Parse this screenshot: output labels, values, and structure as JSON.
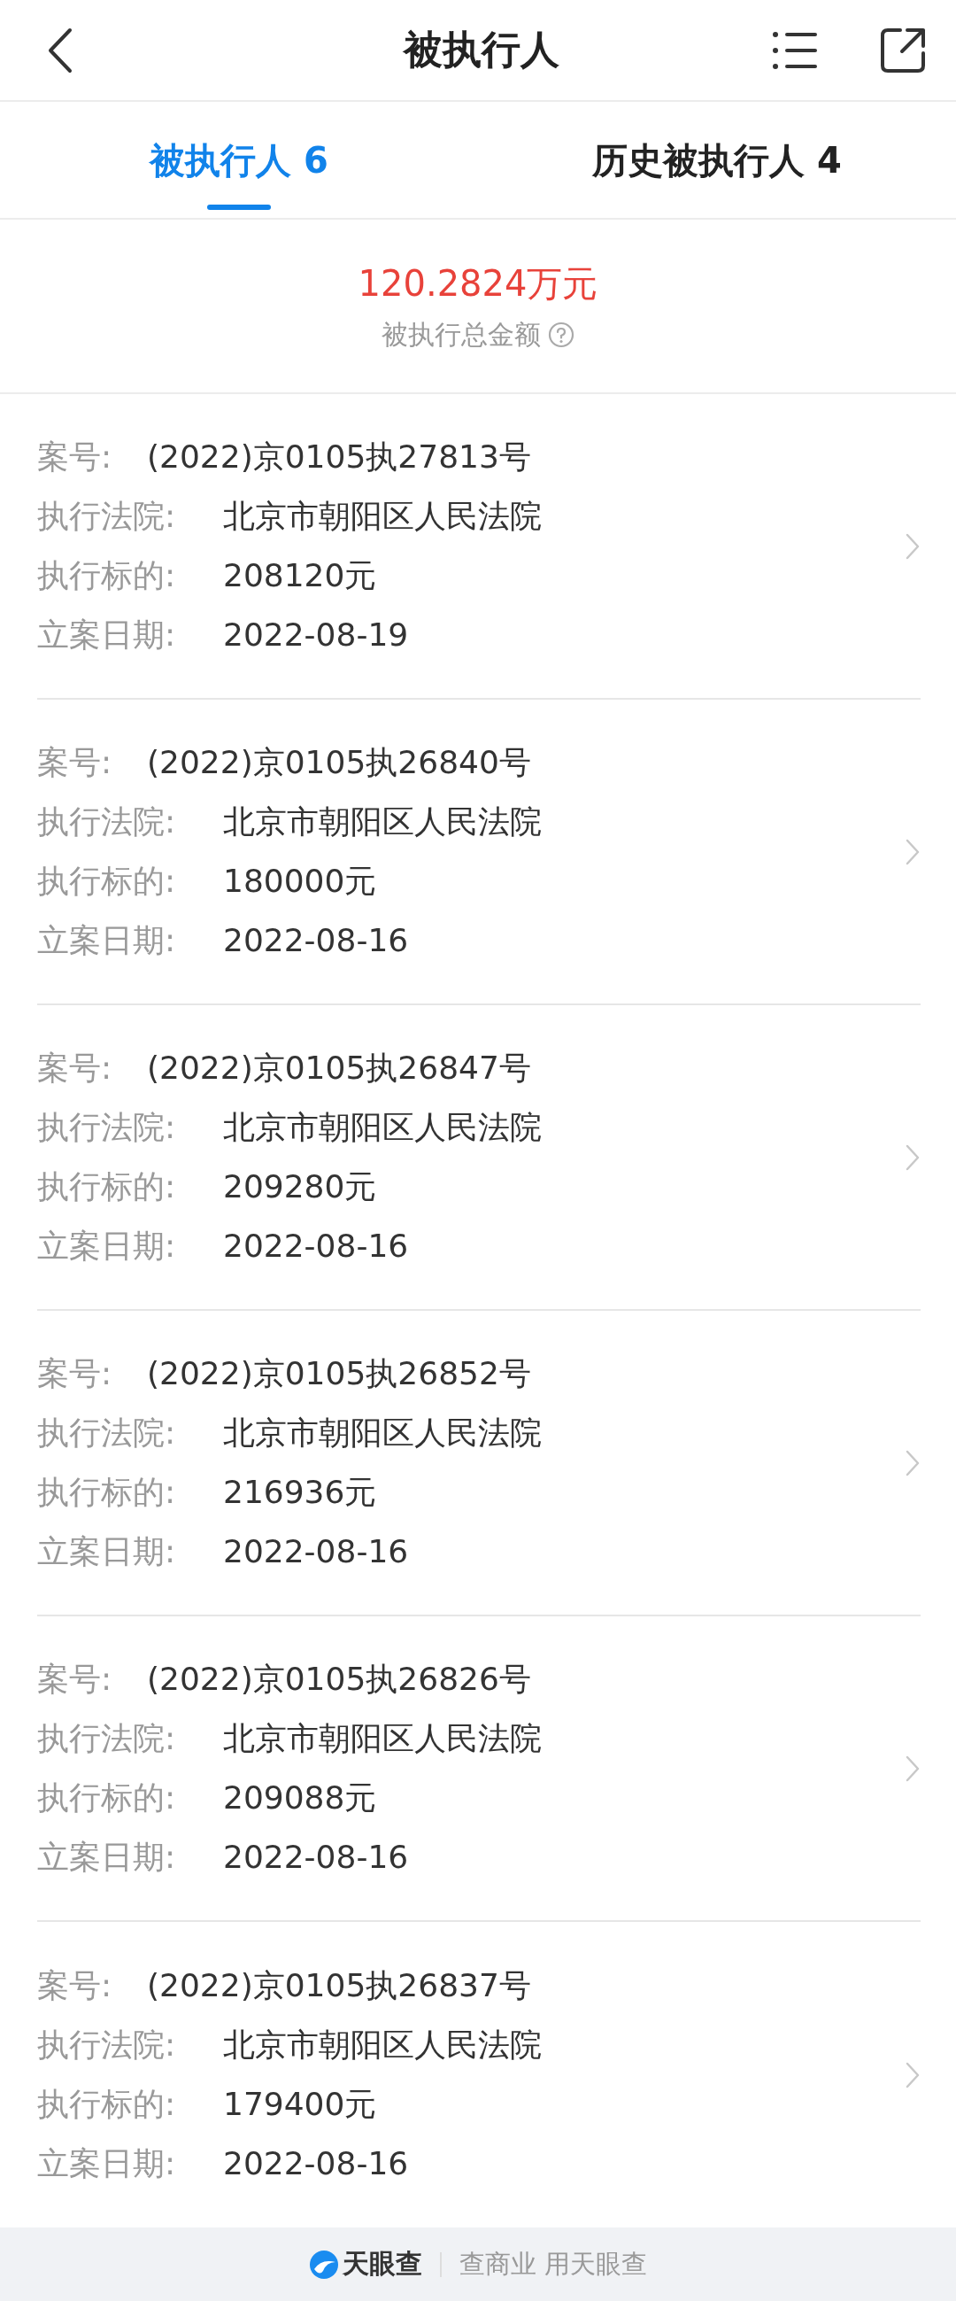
{
  "header": {
    "title": "被执行人"
  },
  "tabs": [
    {
      "label": "被执行人 6",
      "selected": true
    },
    {
      "label": "历史被执行人 4",
      "selected": false
    }
  ],
  "summary": {
    "amount": "120.2824万元",
    "label": "被执行总金额"
  },
  "cases": [
    {
      "fields": [
        {
          "label": "案号:",
          "value": "(2022)京0105执27813号"
        },
        {
          "label": "执行法院:",
          "value": "北京市朝阳区人民法院"
        },
        {
          "label": "执行标的:",
          "value": "208120元"
        },
        {
          "label": "立案日期:",
          "value": "2022-08-19"
        }
      ]
    },
    {
      "fields": [
        {
          "label": "案号:",
          "value": "(2022)京0105执26840号"
        },
        {
          "label": "执行法院:",
          "value": "北京市朝阳区人民法院"
        },
        {
          "label": "执行标的:",
          "value": "180000元"
        },
        {
          "label": "立案日期:",
          "value": "2022-08-16"
        }
      ]
    },
    {
      "fields": [
        {
          "label": "案号:",
          "value": "(2022)京0105执26847号"
        },
        {
          "label": "执行法院:",
          "value": "北京市朝阳区人民法院"
        },
        {
          "label": "执行标的:",
          "value": "209280元"
        },
        {
          "label": "立案日期:",
          "value": "2022-08-16"
        }
      ]
    },
    {
      "fields": [
        {
          "label": "案号:",
          "value": "(2022)京0105执26852号"
        },
        {
          "label": "执行法院:",
          "value": "北京市朝阳区人民法院"
        },
        {
          "label": "执行标的:",
          "value": "216936元"
        },
        {
          "label": "立案日期:",
          "value": "2022-08-16"
        }
      ]
    },
    {
      "fields": [
        {
          "label": "案号:",
          "value": "(2022)京0105执26826号"
        },
        {
          "label": "执行法院:",
          "value": "北京市朝阳区人民法院"
        },
        {
          "label": "执行标的:",
          "value": "209088元"
        },
        {
          "label": "立案日期:",
          "value": "2022-08-16"
        }
      ]
    },
    {
      "fields": [
        {
          "label": "案号:",
          "value": "(2022)京0105执26837号"
        },
        {
          "label": "执行法院:",
          "value": "北京市朝阳区人民法院"
        },
        {
          "label": "执行标的:",
          "value": "179400元"
        },
        {
          "label": "立案日期:",
          "value": "2022-08-16"
        }
      ]
    }
  ],
  "footer": {
    "brand": "天眼查",
    "slogan": "查商业 用天眼查"
  }
}
